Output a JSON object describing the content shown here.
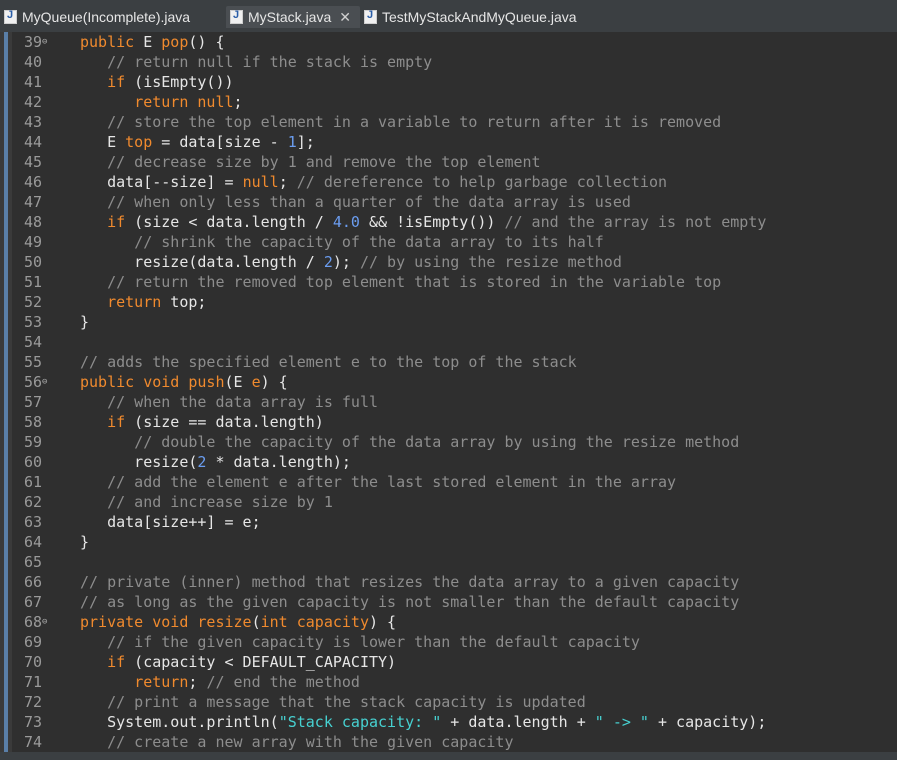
{
  "tabs": [
    {
      "label": "MyQueue(Incomplete).java",
      "active": false,
      "closable": false
    },
    {
      "label": "MyStack.java",
      "active": true,
      "closable": true
    },
    {
      "label": "TestMyStackAndMyQueue.java",
      "active": false,
      "closable": false
    }
  ],
  "close_glyph": "✕",
  "fold_glyph": "⊖",
  "colors": {
    "keyword": "#f08a2e",
    "comment": "#8d8d8d",
    "string": "#47d1d1",
    "number": "#6b9df0",
    "text": "#e6e6e6"
  },
  "lines": [
    {
      "n": "39",
      "fold": true,
      "text": "public E pop() {"
    },
    {
      "n": "40",
      "text": "   // return null if the stack is empty"
    },
    {
      "n": "41",
      "text": "   if (isEmpty())"
    },
    {
      "n": "42",
      "text": "      return null;"
    },
    {
      "n": "43",
      "text": "   // store the top element in a variable to return after it is removed"
    },
    {
      "n": "44",
      "text": "   E top = data[size - 1];"
    },
    {
      "n": "45",
      "text": "   // decrease size by 1 and remove the top element"
    },
    {
      "n": "46",
      "text": "   data[--size] = null; // dereference to help garbage collection"
    },
    {
      "n": "47",
      "text": "   // when only less than a quarter of the data array is used"
    },
    {
      "n": "48",
      "text": "   if (size < data.length / 4.0 && !isEmpty()) // and the array is not empty"
    },
    {
      "n": "49",
      "text": "      // shrink the capacity of the data array to its half"
    },
    {
      "n": "50",
      "text": "      resize(data.length / 2); // by using the resize method"
    },
    {
      "n": "51",
      "text": "   // return the removed top element that is stored in the variable top"
    },
    {
      "n": "52",
      "text": "   return top;"
    },
    {
      "n": "53",
      "text": "}"
    },
    {
      "n": "54",
      "text": ""
    },
    {
      "n": "55",
      "text": "// adds the specified element e to the top of the stack"
    },
    {
      "n": "56",
      "fold": true,
      "text": "public void push(E e) {"
    },
    {
      "n": "57",
      "text": "   // when the data array is full"
    },
    {
      "n": "58",
      "text": "   if (size == data.length)"
    },
    {
      "n": "59",
      "text": "      // double the capacity of the data array by using the resize method"
    },
    {
      "n": "60",
      "text": "      resize(2 * data.length);"
    },
    {
      "n": "61",
      "text": "   // add the element e after the last stored element in the array"
    },
    {
      "n": "62",
      "text": "   // and increase size by 1"
    },
    {
      "n": "63",
      "text": "   data[size++] = e;"
    },
    {
      "n": "64",
      "text": "}"
    },
    {
      "n": "65",
      "text": ""
    },
    {
      "n": "66",
      "text": "// private (inner) method that resizes the data array to a given capacity"
    },
    {
      "n": "67",
      "text": "// as long as the given capacity is not smaller than the default capacity"
    },
    {
      "n": "68",
      "fold": true,
      "text": "private void resize(int capacity) {"
    },
    {
      "n": "69",
      "text": "   // if the given capacity is lower than the default capacity"
    },
    {
      "n": "70",
      "text": "   if (capacity < DEFAULT_CAPACITY)"
    },
    {
      "n": "71",
      "text": "      return; // end the method"
    },
    {
      "n": "72",
      "text": "   // print a message that the stack capacity is updated"
    },
    {
      "n": "73",
      "text": "   System.out.println(\"Stack capacity: \" + data.length + \" -> \" + capacity);"
    },
    {
      "n": "74",
      "text": "   // create a new array with the given capacity"
    }
  ]
}
